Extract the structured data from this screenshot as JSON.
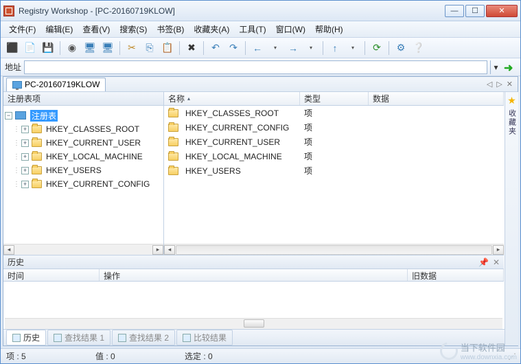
{
  "window": {
    "title": "Registry Workshop - [PC-20160719KLOW]"
  },
  "menu": {
    "file": "文件(F)",
    "edit": "编辑(E)",
    "view": "查看(V)",
    "search": "搜索(S)",
    "bookmark": "书签(B)",
    "favorites": "收藏夹(A)",
    "tools": "工具(T)",
    "window": "窗口(W)",
    "help": "帮助(H)"
  },
  "addr": {
    "label": "地址"
  },
  "tab": {
    "name": "PC-20160719KLOW"
  },
  "sidestar": {
    "label": "收藏夹"
  },
  "tree": {
    "header": "注册表项",
    "root_label": "注册表",
    "items": [
      {
        "label": "HKEY_CLASSES_ROOT"
      },
      {
        "label": "HKEY_CURRENT_USER"
      },
      {
        "label": "HKEY_LOCAL_MACHINE"
      },
      {
        "label": "HKEY_USERS"
      },
      {
        "label": "HKEY_CURRENT_CONFIG"
      }
    ]
  },
  "list": {
    "cols": {
      "name": "名称",
      "type": "类型",
      "data": "数据"
    },
    "rows": [
      {
        "name": "HKEY_CLASSES_ROOT",
        "type": "项"
      },
      {
        "name": "HKEY_CURRENT_CONFIG",
        "type": "项"
      },
      {
        "name": "HKEY_CURRENT_USER",
        "type": "项"
      },
      {
        "name": "HKEY_LOCAL_MACHINE",
        "type": "项"
      },
      {
        "name": "HKEY_USERS",
        "type": "项"
      }
    ]
  },
  "history": {
    "header": "历史",
    "cols": {
      "time": "时间",
      "op": "操作",
      "old": "旧数据"
    }
  },
  "bottomtabs": {
    "history": "历史",
    "find1": "查找结果 1",
    "find2": "查找结果 2",
    "compare": "比较结果"
  },
  "status": {
    "items": "项 : 5",
    "values": "值 : 0",
    "selected": "选定 : 0"
  },
  "watermark": {
    "brand": "当下软件园",
    "url": "www.downxia.com"
  }
}
